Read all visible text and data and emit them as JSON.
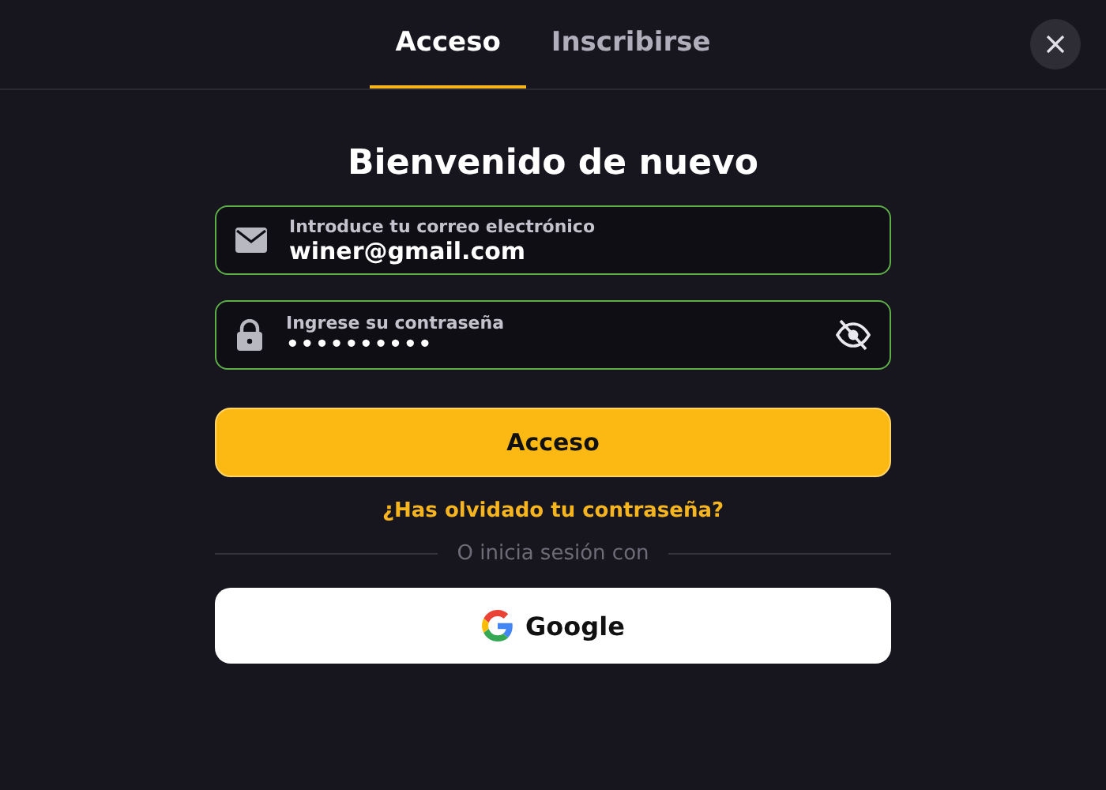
{
  "tabs": [
    {
      "label": "Acceso",
      "selected": true
    },
    {
      "label": "Inscribirse",
      "selected": false
    }
  ],
  "title": "Bienvenido de nuevo",
  "fields": [
    {
      "kind": "email",
      "label": "Introduce tu correo electrónico",
      "value": "winer@gmail.com"
    },
    {
      "kind": "password",
      "label": "Ingrese su contraseña",
      "value": "••••••••••"
    }
  ],
  "submit": "Acceso",
  "forgot": "¿Has olvidado tu contraseña?",
  "divider": "O inicia sesión con",
  "google": "Google"
}
